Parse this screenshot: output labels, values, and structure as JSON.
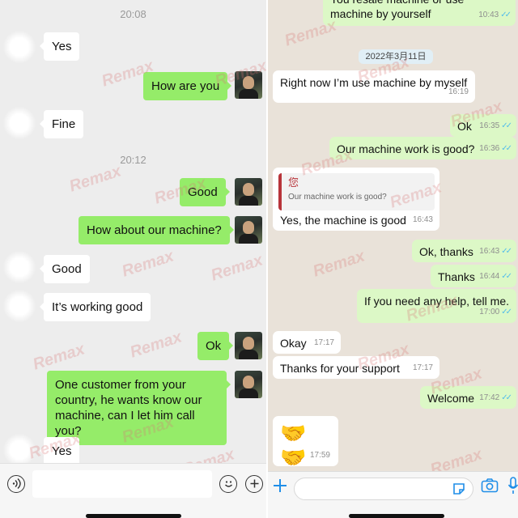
{
  "watermark": "Remax",
  "colors": {
    "wechat_out": "#95ec69",
    "whatsapp_out": "#dcf8c6",
    "read_ticks": "#53bdeb",
    "quote_accent": "#b8343a"
  },
  "wechat": {
    "time_1": "20:08",
    "time_2": "20:12",
    "messages": [
      {
        "side": "in",
        "text": "Yes"
      },
      {
        "side": "out",
        "text": "How are you"
      },
      {
        "side": "in",
        "text": "Fine"
      },
      {
        "side": "out",
        "text": "Good"
      },
      {
        "side": "out",
        "text": "How about our machine?"
      },
      {
        "side": "in",
        "text": "Good"
      },
      {
        "side": "in",
        "text": "It’s working good"
      },
      {
        "side": "out",
        "text": "Ok"
      },
      {
        "side": "out",
        "text": "One customer from your country, he wants know our machine, can I let him call you?"
      },
      {
        "side": "in",
        "text": "Yes"
      }
    ],
    "input_bar": {
      "voice_icon": "voice-icon",
      "emoji_icon": "emoji-icon",
      "plus_icon": "plus-icon"
    }
  },
  "whatsapp": {
    "date": "2022年3月11日",
    "messages": [
      {
        "side": "out",
        "text": "You resale machine or use machine by yourself",
        "time": "10:43",
        "ticks": "✓✓"
      },
      {
        "side": "in",
        "text": "Right now I’m use machine by myself",
        "time": "16:19"
      },
      {
        "side": "out",
        "text": "Ok",
        "time": "16:35",
        "ticks": "✓✓"
      },
      {
        "side": "out",
        "text": "Our machine work is good?",
        "time": "16:36",
        "ticks": "✓✓"
      },
      {
        "side": "in",
        "quote_name": "您",
        "quote_text": "Our machine work is good?",
        "text": "Yes, the machine is good",
        "time": "16:43"
      },
      {
        "side": "out",
        "text": "Ok,  thanks",
        "time": "16:43",
        "ticks": "✓✓"
      },
      {
        "side": "out",
        "text": "Thanks",
        "time": "16:44",
        "ticks": "✓✓"
      },
      {
        "side": "out",
        "text": "If you need any help, tell me.",
        "time": "17:00",
        "ticks": "✓✓"
      },
      {
        "side": "in",
        "text": "Okay",
        "time": "17:17"
      },
      {
        "side": "in",
        "text": "Thanks for your support",
        "time": "17:17"
      },
      {
        "side": "out",
        "text": "Welcome",
        "time": "17:42",
        "ticks": "✓✓"
      },
      {
        "side": "in",
        "text": "🤝🤝",
        "time": "17:59"
      }
    ],
    "input_bar": {
      "plus_icon": "plus-icon",
      "sticker_icon": "sticker-icon",
      "camera_icon": "camera-icon",
      "mic_icon": "microphone-icon"
    }
  }
}
